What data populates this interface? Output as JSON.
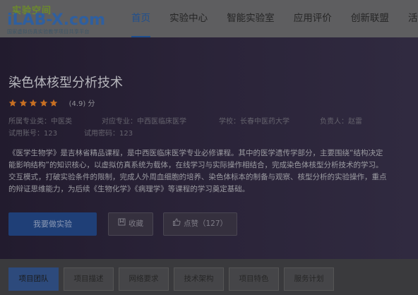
{
  "brand": {
    "top": "实验空间",
    "mark_prefix": "iLAB-",
    "mark_x": "X",
    "mark_suffix": ".com",
    "subtitle": "国家虚拟仿真实验教学项目共享平台"
  },
  "nav": {
    "items": [
      {
        "label": "首页",
        "active": true
      },
      {
        "label": "实验中心"
      },
      {
        "label": "智能实验室"
      },
      {
        "label": "应用评价"
      },
      {
        "label": "创新联盟"
      },
      {
        "label": "活动"
      }
    ]
  },
  "course": {
    "title": "染色体核型分析技术",
    "rating": 4.9,
    "rating_text": "(4.9) 分",
    "star_color": "#c76f22",
    "category": "所属专业类：中医类",
    "major": "对应专业：中西医临床医学",
    "school": "学校：长春中医药大学",
    "owner": "负责人：赵雷",
    "account": "试用账号：123",
    "password": "试用密码：123",
    "description": [
      "《医学生物学》是吉林省精品课程，是中西医临床医学专业必修课程。其中的医学遗传学部分，主要围绕“结构决定",
      "能影响结构”的知识核心，以虚拟仿真系统为载体，在线学习与实际操作相结合，完成染色体核型分析技术的学习。",
      "交互模式，打破实验条件的限制，完成人外周血细胞的培养、染色体标本的制备与观察、核型分析的实验操作，重点",
      "的辩证思维能力，为后续《生物化学》《病理学》等课程的学习奠定基础。"
    ]
  },
  "actions": {
    "do_experiment": "我要做实验",
    "favorite": "收藏",
    "like": "点赞（127）"
  },
  "tabs": [
    {
      "label": "项目团队",
      "active": true
    },
    {
      "label": "项目描述"
    },
    {
      "label": "网络要求"
    },
    {
      "label": "技术架构"
    },
    {
      "label": "项目特色"
    },
    {
      "label": "服务计划"
    }
  ]
}
